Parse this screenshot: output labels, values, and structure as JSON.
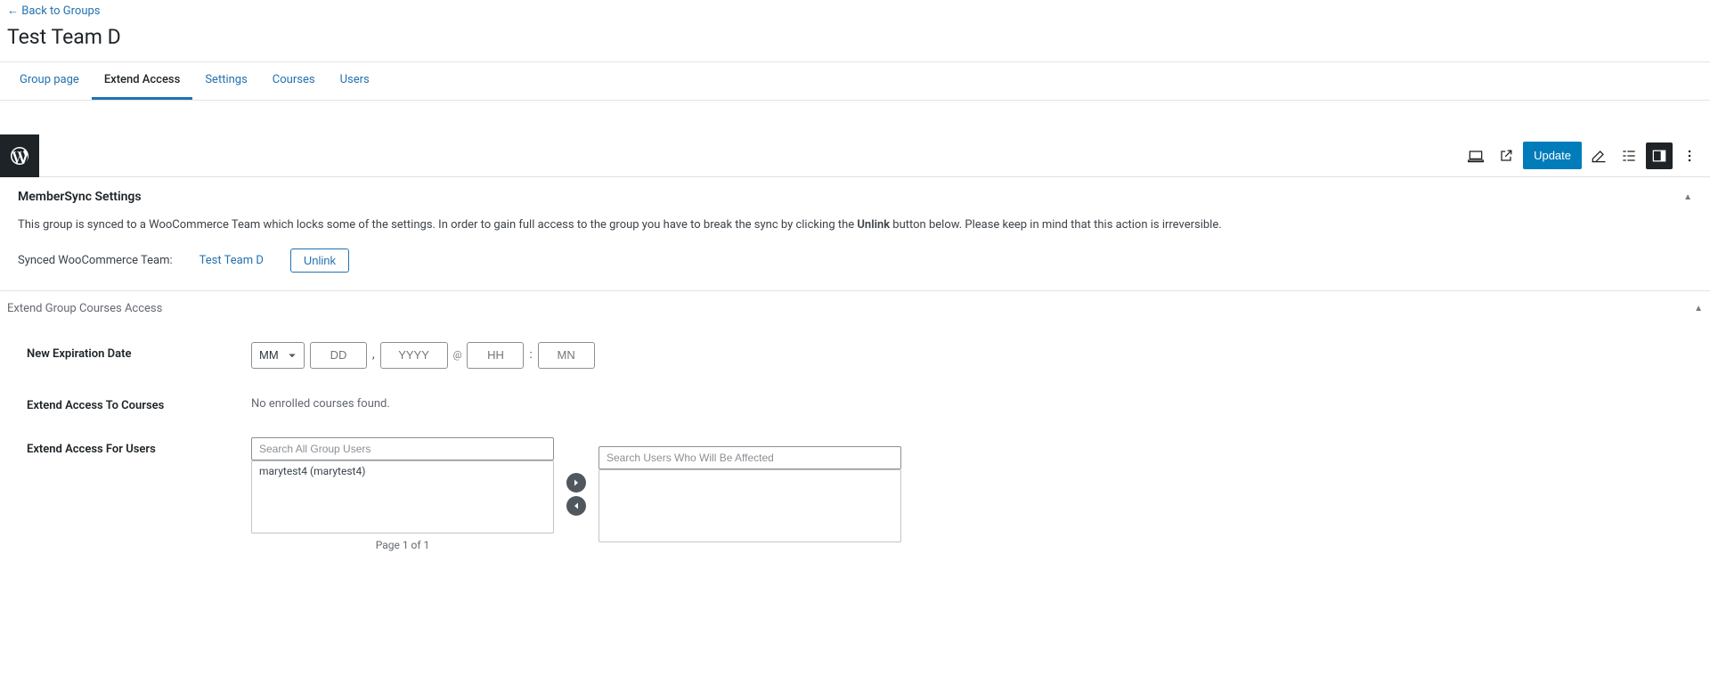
{
  "back_link": "← Back to Groups",
  "page_title": "Test Team D",
  "tabs": {
    "group_page": "Group page",
    "extend_access": "Extend Access",
    "settings": "Settings",
    "courses": "Courses",
    "users": "Users"
  },
  "toolbar": {
    "update": "Update"
  },
  "membersync": {
    "title": "MemberSync Settings",
    "desc_prefix": "This group is synced to a WooCommerce Team which locks some of the settings. In order to gain full access to the group you have to break the sync by clicking the ",
    "desc_bold": "Unlink",
    "desc_suffix": " button below. Please keep in mind that this action is irreversible.",
    "synced_label": "Synced WooCommerce Team:",
    "team_link": "Test Team D",
    "unlink_btn": "Unlink"
  },
  "extend": {
    "title": "Extend Group Courses Access",
    "new_exp_label": "New Expiration Date",
    "month_placeholder": "MM",
    "day_placeholder": "DD",
    "year_placeholder": "YYYY",
    "hour_placeholder": "HH",
    "minute_placeholder": "MN",
    "courses_label": "Extend Access To Courses",
    "no_courses": "No enrolled courses found.",
    "users_label": "Extend Access For Users",
    "search_all_placeholder": "Search All Group Users",
    "search_affected_placeholder": "Search Users Who Will Be Affected",
    "user_items": [
      "marytest4 (marytest4)"
    ],
    "pagination": "Page 1 of 1"
  }
}
